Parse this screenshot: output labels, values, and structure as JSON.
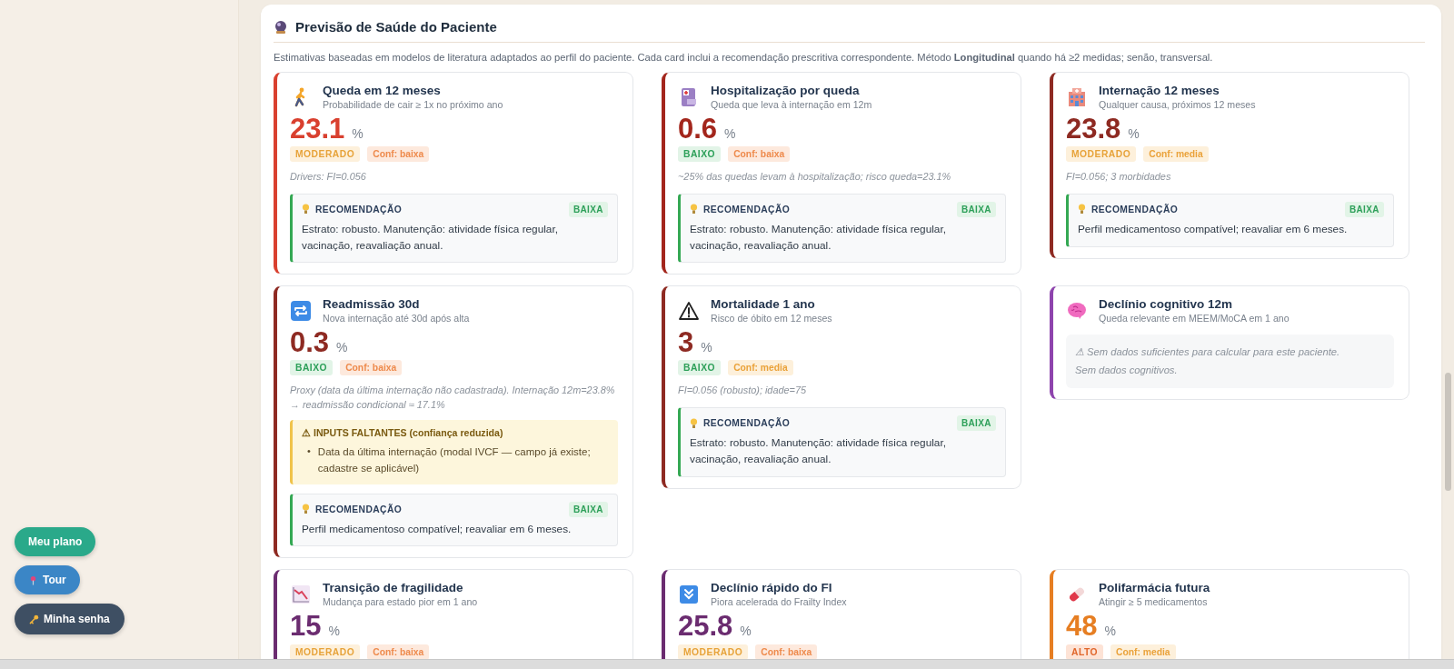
{
  "panel": {
    "title": "Previsão de Saúde do Paciente",
    "description": "Estimativas baseadas em modelos de literatura adaptados ao perfil do paciente. Cada card inclui a recomendação prescritiva correspondente. Método **Longitudinal** quando há ≥2 medidas; senão, transversal."
  },
  "cards": [
    {
      "kind": "walker",
      "color": "#d9402f",
      "title": "Queda em 12 meses",
      "subtitle": "Probabilidade de cair ≥ 1x no próximo ano",
      "value": "23.1",
      "unit": "%",
      "risk": {
        "label": "MODERADO",
        "kind": "moderate"
      },
      "confidence": {
        "label": "Conf: baixa",
        "kind": "low"
      },
      "note": "Drivers: FI=0.056",
      "recommendation": {
        "label": "RECOMENDAÇÃO",
        "priority": "BAIXA",
        "text": "Estrato: robusto. Manutenção: atividade física regular, vacinação, reavaliação anual."
      }
    },
    {
      "kind": "clipboard",
      "color": "#a3261c",
      "title": "Hospitalização por queda",
      "subtitle": "Queda que leva à internação em 12m",
      "value": "0.6",
      "unit": "%",
      "risk": {
        "label": "BAIXO",
        "kind": "low"
      },
      "confidence": {
        "label": "Conf: baixa",
        "kind": "low"
      },
      "note": "~25% das quedas levam à hospitalização; risco queda=23.1%",
      "recommendation": {
        "label": "RECOMENDAÇÃO",
        "priority": "BAIXA",
        "text": "Estrato: robusto. Manutenção: atividade física regular, vacinação, reavaliação anual."
      }
    },
    {
      "kind": "hospital",
      "color": "#8e2a22",
      "title": "Internação 12 meses",
      "subtitle": "Qualquer causa, próximos 12 meses",
      "value": "23.8",
      "unit": "%",
      "risk": {
        "label": "MODERADO",
        "kind": "moderate"
      },
      "confidence": {
        "label": "Conf: media",
        "kind": "medium"
      },
      "note": "FI=0.056; 3 morbidades",
      "recommendation": {
        "label": "RECOMENDAÇÃO",
        "priority": "BAIXA",
        "text": "Perfil medicamentoso compatível; reavaliar em 6 meses."
      }
    },
    {
      "kind": "repeat",
      "color": "#8e2a22",
      "title": "Readmissão 30d",
      "subtitle": "Nova internação até 30d após alta",
      "value": "0.3",
      "unit": "%",
      "risk": {
        "label": "BAIXO",
        "kind": "low"
      },
      "confidence": {
        "label": "Conf: baixa",
        "kind": "low"
      },
      "note": "Proxy (data da última internação não cadastrada). Internação 12m=23.8% → readmissão condicional ≈ 17.1%",
      "missing": {
        "title": "⚠ INPUTS FALTANTES (confiança reduzida)",
        "items": [
          {
            "bullet": "•",
            "text": "Data da última internação (modal IVCF — campo já existe; cadastre se aplicável)"
          }
        ]
      },
      "recommendation": {
        "label": "RECOMENDAÇÃO",
        "priority": "BAIXA",
        "text": "Perfil medicamentoso compatível; reavaliar em 6 meses."
      }
    },
    {
      "kind": "warning",
      "color": "#8e2a22",
      "title": "Mortalidade 1 ano",
      "subtitle": "Risco de óbito em 12 meses",
      "value": "3",
      "unit": "%",
      "risk": {
        "label": "BAIXO",
        "kind": "low"
      },
      "confidence": {
        "label": "Conf: media",
        "kind": "medium"
      },
      "note": "FI=0.056 (robusto); idade=75",
      "recommendation": {
        "label": "RECOMENDAÇÃO",
        "priority": "BAIXA",
        "text": "Estrato: robusto. Manutenção: atividade física regular, vacinação, reavaliação anual."
      }
    },
    {
      "kind": "brain",
      "color": "#8e44ad",
      "title": "Declínio cognitivo 12m",
      "subtitle": "Queda relevante em MEEM/MoCA em 1 ano",
      "no_data": [
        "⚠ Sem dados suficientes para calcular para este paciente.",
        "Sem dados cognitivos."
      ]
    },
    {
      "kind": "chart",
      "color": "#6b2c70",
      "title": "Transição de fragilidade",
      "subtitle": "Mudança para estado pior em 1 ano",
      "value": "15",
      "unit": "%",
      "risk": {
        "label": "MODERADO",
        "kind": "moderate"
      },
      "confidence": {
        "label": "Conf: baixa",
        "kind": "low"
      }
    },
    {
      "kind": "down",
      "color": "#6b2c70",
      "title": "Declínio rápido do FI",
      "subtitle": "Piora acelerada do Frailty Index",
      "value": "25.8",
      "unit": "%",
      "risk": {
        "label": "MODERADO",
        "kind": "moderate"
      },
      "confidence": {
        "label": "Conf: baixa",
        "kind": "low"
      }
    },
    {
      "kind": "pill",
      "color": "#e67e22",
      "title": "Polifarmácia futura",
      "subtitle": "Atingir ≥ 5 medicamentos",
      "value": "48",
      "unit": "%",
      "risk": {
        "label": "ALTO",
        "kind": "high"
      },
      "confidence": {
        "label": "Conf: media",
        "kind": "medium"
      }
    }
  ],
  "floating_buttons": [
    {
      "label": "Meu plano",
      "kind": "plan"
    },
    {
      "label": "Tour",
      "kind": "tour"
    },
    {
      "label": "Minha senha",
      "kind": "password"
    }
  ]
}
